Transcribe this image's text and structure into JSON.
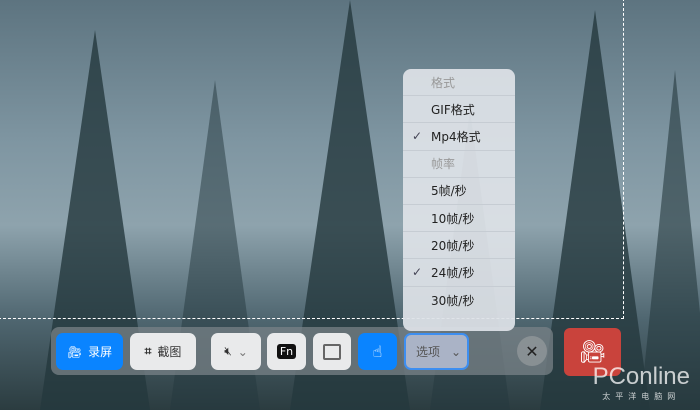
{
  "toolbar": {
    "record_label": "录屏",
    "screenshot_label": "截图",
    "fn_label": "Fn",
    "options_label": "选项"
  },
  "menu": {
    "items": [
      {
        "label": "格式",
        "disabled": true,
        "checked": false
      },
      {
        "label": "GIF格式",
        "disabled": false,
        "checked": false
      },
      {
        "label": "Mp4格式",
        "disabled": false,
        "checked": true
      },
      {
        "label": "帧率",
        "disabled": true,
        "checked": false
      },
      {
        "label": "5帧/秒",
        "disabled": false,
        "checked": false
      },
      {
        "label": "10帧/秒",
        "disabled": false,
        "checked": false
      },
      {
        "label": "20帧/秒",
        "disabled": false,
        "checked": false
      },
      {
        "label": "24帧/秒",
        "disabled": false,
        "checked": true
      },
      {
        "label": "30帧/秒",
        "disabled": false,
        "checked": false
      }
    ],
    "check_mark": "✓"
  },
  "watermark": {
    "brand": "PConline",
    "sub": "太平洋电脑网"
  },
  "colors": {
    "accent": "#0a84ff",
    "record": "#c9433c"
  }
}
